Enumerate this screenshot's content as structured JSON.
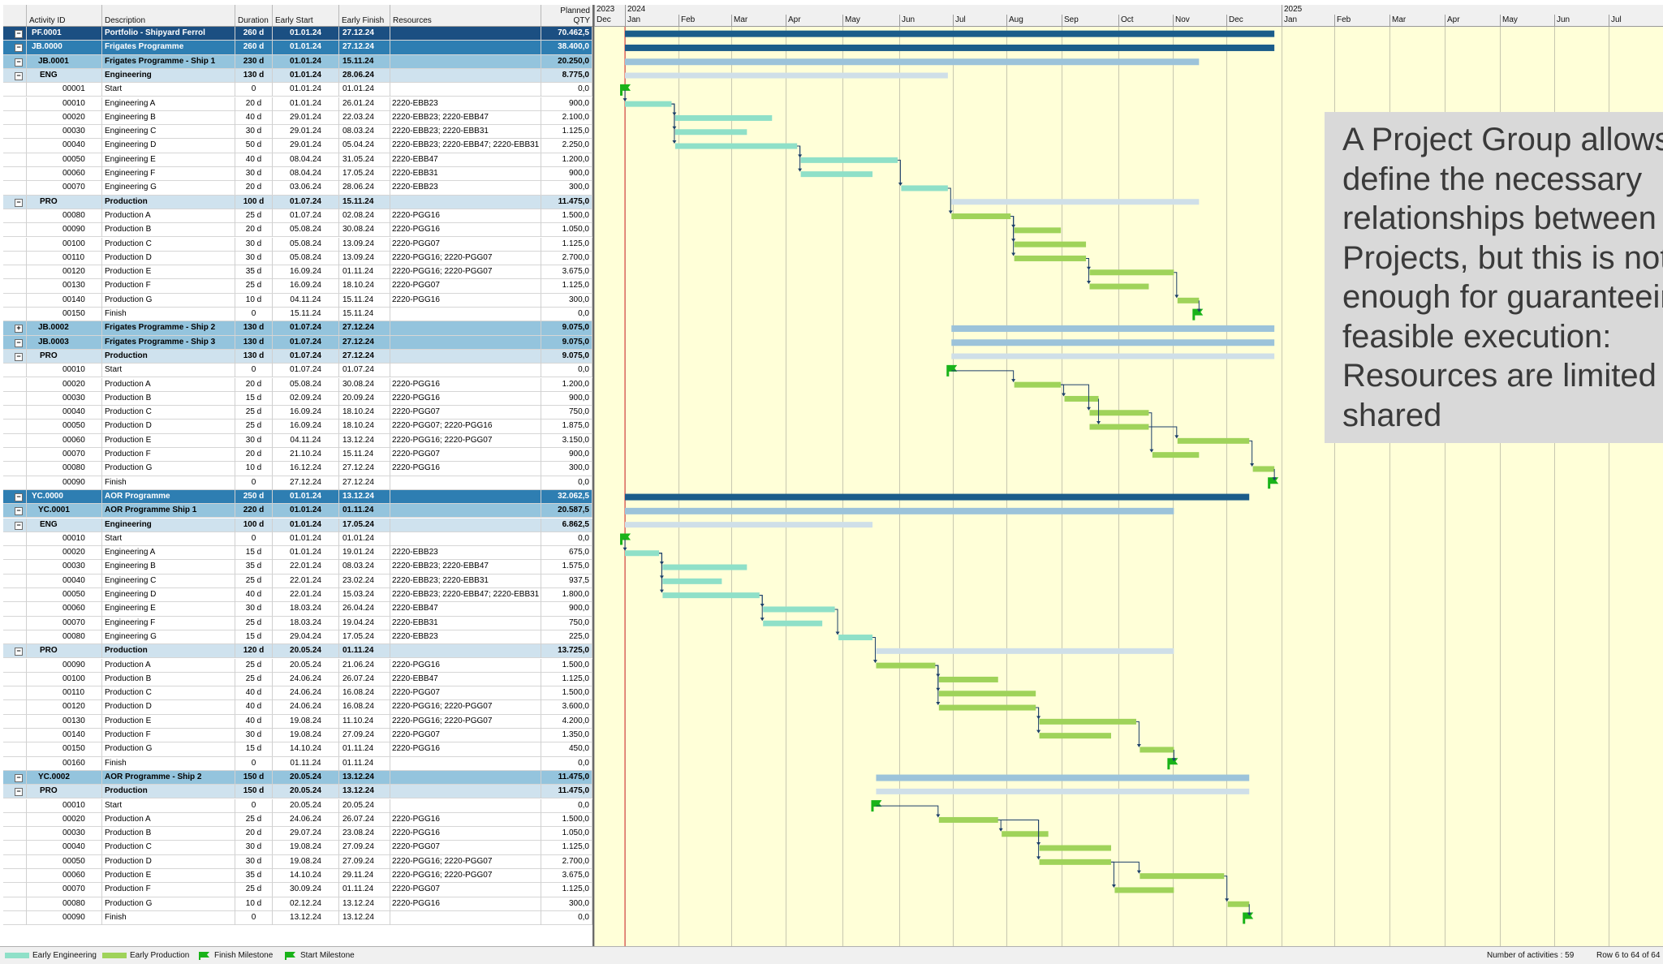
{
  "columns": {
    "id": "Activity ID",
    "desc": "Description",
    "duration": "Duration",
    "early_start": "Early Start",
    "early_finish": "Early Finish",
    "resources": "Resources",
    "qty_line1": "Planned",
    "qty_line2": "QTY"
  },
  "timeline": {
    "years": [
      "2023",
      "2024",
      "2025"
    ],
    "months": [
      "Dec",
      "Jan",
      "Feb",
      "Mar",
      "Apr",
      "May",
      "Jun",
      "Jul",
      "Aug",
      "Sep",
      "Oct",
      "Nov",
      "Dec",
      "Jan",
      "Feb",
      "Mar",
      "Apr",
      "May",
      "Jun",
      "Jul"
    ]
  },
  "rows": [
    {
      "level": 0,
      "toggle": "−",
      "id": "PF.0001",
      "desc": "Portfolio - Shipyard Ferrol",
      "dur": "260 d",
      "es": "01.01.24",
      "ef": "27.12.24",
      "res": "",
      "qty": "70.462,5"
    },
    {
      "level": 1,
      "toggle": "−",
      "id": "JB.0000",
      "desc": "Frigates Programme",
      "dur": "260 d",
      "es": "01.01.24",
      "ef": "27.12.24",
      "res": "",
      "qty": "38.400,0"
    },
    {
      "level": 2,
      "toggle": "−",
      "id": "JB.0001",
      "desc": "Frigates Programme - Ship 1",
      "dur": "230 d",
      "es": "01.01.24",
      "ef": "15.11.24",
      "res": "",
      "qty": "20.250,0"
    },
    {
      "level": 3,
      "toggle": "−",
      "id": "ENG",
      "desc": "Engineering",
      "dur": "130 d",
      "es": "01.01.24",
      "ef": "28.06.24",
      "res": "",
      "qty": "8.775,0"
    },
    {
      "level": 4,
      "id": "00001",
      "desc": "Start",
      "dur": "0",
      "es": "01.01.24",
      "ef": "01.01.24",
      "res": "",
      "qty": "0,0"
    },
    {
      "level": 4,
      "id": "00010",
      "desc": "Engineering A",
      "dur": "20 d",
      "es": "01.01.24",
      "ef": "26.01.24",
      "res": "2220-EBB23",
      "qty": "900,0"
    },
    {
      "level": 4,
      "id": "00020",
      "desc": "Engineering B",
      "dur": "40 d",
      "es": "29.01.24",
      "ef": "22.03.24",
      "res": "2220-EBB23; 2220-EBB47",
      "qty": "2.100,0"
    },
    {
      "level": 4,
      "id": "00030",
      "desc": "Engineering C",
      "dur": "30 d",
      "es": "29.01.24",
      "ef": "08.03.24",
      "res": "2220-EBB23; 2220-EBB31",
      "qty": "1.125,0"
    },
    {
      "level": 4,
      "id": "00040",
      "desc": "Engineering D",
      "dur": "50 d",
      "es": "29.01.24",
      "ef": "05.04.24",
      "res": "2220-EBB23; 2220-EBB47; 2220-EBB31",
      "qty": "2.250,0"
    },
    {
      "level": 4,
      "id": "00050",
      "desc": "Engineering E",
      "dur": "40 d",
      "es": "08.04.24",
      "ef": "31.05.24",
      "res": "2220-EBB47",
      "qty": "1.200,0"
    },
    {
      "level": 4,
      "id": "00060",
      "desc": "Engineering F",
      "dur": "30 d",
      "es": "08.04.24",
      "ef": "17.05.24",
      "res": "2220-EBB31",
      "qty": "900,0"
    },
    {
      "level": 4,
      "id": "00070",
      "desc": "Engineering G",
      "dur": "20 d",
      "es": "03.06.24",
      "ef": "28.06.24",
      "res": "2220-EBB23",
      "qty": "300,0"
    },
    {
      "level": 3,
      "toggle": "−",
      "id": "PRO",
      "desc": "Production",
      "dur": "100 d",
      "es": "01.07.24",
      "ef": "15.11.24",
      "res": "",
      "qty": "11.475,0"
    },
    {
      "level": 4,
      "id": "00080",
      "desc": "Production A",
      "dur": "25 d",
      "es": "01.07.24",
      "ef": "02.08.24",
      "res": "2220-PGG16",
      "qty": "1.500,0"
    },
    {
      "level": 4,
      "id": "00090",
      "desc": "Production B",
      "dur": "20 d",
      "es": "05.08.24",
      "ef": "30.08.24",
      "res": "2220-PGG16",
      "qty": "1.050,0"
    },
    {
      "level": 4,
      "id": "00100",
      "desc": "Production C",
      "dur": "30 d",
      "es": "05.08.24",
      "ef": "13.09.24",
      "res": "2220-PGG07",
      "qty": "1.125,0"
    },
    {
      "level": 4,
      "id": "00110",
      "desc": "Production D",
      "dur": "30 d",
      "es": "05.08.24",
      "ef": "13.09.24",
      "res": "2220-PGG16; 2220-PGG07",
      "qty": "2.700,0"
    },
    {
      "level": 4,
      "id": "00120",
      "desc": "Production E",
      "dur": "35 d",
      "es": "16.09.24",
      "ef": "01.11.24",
      "res": "2220-PGG16; 2220-PGG07",
      "qty": "3.675,0"
    },
    {
      "level": 4,
      "id": "00130",
      "desc": "Production F",
      "dur": "25 d",
      "es": "16.09.24",
      "ef": "18.10.24",
      "res": "2220-PGG07",
      "qty": "1.125,0"
    },
    {
      "level": 4,
      "id": "00140",
      "desc": "Production G",
      "dur": "10 d",
      "es": "04.11.24",
      "ef": "15.11.24",
      "res": "2220-PGG16",
      "qty": "300,0"
    },
    {
      "level": 4,
      "id": "00150",
      "desc": "Finish",
      "dur": "0",
      "es": "15.11.24",
      "ef": "15.11.24",
      "res": "",
      "qty": "0,0"
    },
    {
      "level": 2,
      "toggle": "+",
      "id": "JB.0002",
      "desc": "Frigates Programme - Ship 2",
      "dur": "130 d",
      "es": "01.07.24",
      "ef": "27.12.24",
      "res": "",
      "qty": "9.075,0"
    },
    {
      "level": 2,
      "toggle": "−",
      "id": "JB.0003",
      "desc": "Frigates Programme - Ship 3",
      "dur": "130 d",
      "es": "01.07.24",
      "ef": "27.12.24",
      "res": "",
      "qty": "9.075,0"
    },
    {
      "level": 3,
      "toggle": "−",
      "id": "PRO",
      "desc": "Production",
      "dur": "130 d",
      "es": "01.07.24",
      "ef": "27.12.24",
      "res": "",
      "qty": "9.075,0"
    },
    {
      "level": 4,
      "id": "00010",
      "desc": "Start",
      "dur": "0",
      "es": "01.07.24",
      "ef": "01.07.24",
      "res": "",
      "qty": "0,0"
    },
    {
      "level": 4,
      "id": "00020",
      "desc": "Production A",
      "dur": "20 d",
      "es": "05.08.24",
      "ef": "30.08.24",
      "res": "2220-PGG16",
      "qty": "1.200,0"
    },
    {
      "level": 4,
      "id": "00030",
      "desc": "Production B",
      "dur": "15 d",
      "es": "02.09.24",
      "ef": "20.09.24",
      "res": "2220-PGG16",
      "qty": "900,0"
    },
    {
      "level": 4,
      "id": "00040",
      "desc": "Production C",
      "dur": "25 d",
      "es": "16.09.24",
      "ef": "18.10.24",
      "res": "2220-PGG07",
      "qty": "750,0"
    },
    {
      "level": 4,
      "id": "00050",
      "desc": "Production D",
      "dur": "25 d",
      "es": "16.09.24",
      "ef": "18.10.24",
      "res": "2220-PGG07; 2220-PGG16",
      "qty": "1.875,0"
    },
    {
      "level": 4,
      "id": "00060",
      "desc": "Production E",
      "dur": "30 d",
      "es": "04.11.24",
      "ef": "13.12.24",
      "res": "2220-PGG16; 2220-PGG07",
      "qty": "3.150,0"
    },
    {
      "level": 4,
      "id": "00070",
      "desc": "Production F",
      "dur": "20 d",
      "es": "21.10.24",
      "ef": "15.11.24",
      "res": "2220-PGG07",
      "qty": "900,0"
    },
    {
      "level": 4,
      "id": "00080",
      "desc": "Production G",
      "dur": "10 d",
      "es": "16.12.24",
      "ef": "27.12.24",
      "res": "2220-PGG16",
      "qty": "300,0"
    },
    {
      "level": 4,
      "id": "00090",
      "desc": "Finish",
      "dur": "0",
      "es": "27.12.24",
      "ef": "27.12.24",
      "res": "",
      "qty": "0,0"
    },
    {
      "level": 1,
      "toggle": "−",
      "id": "YC.0000",
      "desc": "AOR Programme",
      "dur": "250 d",
      "es": "01.01.24",
      "ef": "13.12.24",
      "res": "",
      "qty": "32.062,5"
    },
    {
      "level": 2,
      "toggle": "−",
      "id": "YC.0001",
      "desc": "AOR Programme Ship 1",
      "dur": "220 d",
      "es": "01.01.24",
      "ef": "01.11.24",
      "res": "",
      "qty": "20.587,5"
    },
    {
      "level": 3,
      "toggle": "−",
      "id": "ENG",
      "desc": "Engineering",
      "dur": "100 d",
      "es": "01.01.24",
      "ef": "17.05.24",
      "res": "",
      "qty": "6.862,5"
    },
    {
      "level": 4,
      "id": "00010",
      "desc": "Start",
      "dur": "0",
      "es": "01.01.24",
      "ef": "01.01.24",
      "res": "",
      "qty": "0,0"
    },
    {
      "level": 4,
      "id": "00020",
      "desc": "Engineering A",
      "dur": "15 d",
      "es": "01.01.24",
      "ef": "19.01.24",
      "res": "2220-EBB23",
      "qty": "675,0"
    },
    {
      "level": 4,
      "id": "00030",
      "desc": "Engineering B",
      "dur": "35 d",
      "es": "22.01.24",
      "ef": "08.03.24",
      "res": "2220-EBB23; 2220-EBB47",
      "qty": "1.575,0"
    },
    {
      "level": 4,
      "id": "00040",
      "desc": "Engineering C",
      "dur": "25 d",
      "es": "22.01.24",
      "ef": "23.02.24",
      "res": "2220-EBB23; 2220-EBB31",
      "qty": "937,5"
    },
    {
      "level": 4,
      "id": "00050",
      "desc": "Engineering D",
      "dur": "40 d",
      "es": "22.01.24",
      "ef": "15.03.24",
      "res": "2220-EBB23; 2220-EBB47; 2220-EBB31",
      "qty": "1.800,0"
    },
    {
      "level": 4,
      "id": "00060",
      "desc": "Engineering E",
      "dur": "30 d",
      "es": "18.03.24",
      "ef": "26.04.24",
      "res": "2220-EBB47",
      "qty": "900,0"
    },
    {
      "level": 4,
      "id": "00070",
      "desc": "Engineering F",
      "dur": "25 d",
      "es": "18.03.24",
      "ef": "19.04.24",
      "res": "2220-EBB31",
      "qty": "750,0"
    },
    {
      "level": 4,
      "id": "00080",
      "desc": "Engineering G",
      "dur": "15 d",
      "es": "29.04.24",
      "ef": "17.05.24",
      "res": "2220-EBB23",
      "qty": "225,0"
    },
    {
      "level": 3,
      "toggle": "−",
      "id": "PRO",
      "desc": "Production",
      "dur": "120 d",
      "es": "20.05.24",
      "ef": "01.11.24",
      "res": "",
      "qty": "13.725,0"
    },
    {
      "level": 4,
      "id": "00090",
      "desc": "Production A",
      "dur": "25 d",
      "es": "20.05.24",
      "ef": "21.06.24",
      "res": "2220-PGG16",
      "qty": "1.500,0"
    },
    {
      "level": 4,
      "id": "00100",
      "desc": "Production B",
      "dur": "25 d",
      "es": "24.06.24",
      "ef": "26.07.24",
      "res": "2220-EBB47",
      "qty": "1.125,0"
    },
    {
      "level": 4,
      "id": "00110",
      "desc": "Production C",
      "dur": "40 d",
      "es": "24.06.24",
      "ef": "16.08.24",
      "res": "2220-PGG07",
      "qty": "1.500,0"
    },
    {
      "level": 4,
      "id": "00120",
      "desc": "Production D",
      "dur": "40 d",
      "es": "24.06.24",
      "ef": "16.08.24",
      "res": "2220-PGG16; 2220-PGG07",
      "qty": "3.600,0"
    },
    {
      "level": 4,
      "id": "00130",
      "desc": "Production E",
      "dur": "40 d",
      "es": "19.08.24",
      "ef": "11.10.24",
      "res": "2220-PGG16; 2220-PGG07",
      "qty": "4.200,0"
    },
    {
      "level": 4,
      "id": "00140",
      "desc": "Production F",
      "dur": "30 d",
      "es": "19.08.24",
      "ef": "27.09.24",
      "res": "2220-PGG07",
      "qty": "1.350,0"
    },
    {
      "level": 4,
      "id": "00150",
      "desc": "Production G",
      "dur": "15 d",
      "es": "14.10.24",
      "ef": "01.11.24",
      "res": "2220-PGG16",
      "qty": "450,0"
    },
    {
      "level": 4,
      "id": "00160",
      "desc": "Finish",
      "dur": "0",
      "es": "01.11.24",
      "ef": "01.11.24",
      "res": "",
      "qty": "0,0"
    },
    {
      "level": 2,
      "toggle": "−",
      "id": "YC.0002",
      "desc": "AOR Programme - Ship 2",
      "dur": "150 d",
      "es": "20.05.24",
      "ef": "13.12.24",
      "res": "",
      "qty": "11.475,0"
    },
    {
      "level": 3,
      "toggle": "−",
      "id": "PRO",
      "desc": "Production",
      "dur": "150 d",
      "es": "20.05.24",
      "ef": "13.12.24",
      "res": "",
      "qty": "11.475,0"
    },
    {
      "level": 4,
      "id": "00010",
      "desc": "Start",
      "dur": "0",
      "es": "20.05.24",
      "ef": "20.05.24",
      "res": "",
      "qty": "0,0"
    },
    {
      "level": 4,
      "id": "00020",
      "desc": "Production A",
      "dur": "25 d",
      "es": "24.06.24",
      "ef": "26.07.24",
      "res": "2220-PGG16",
      "qty": "1.500,0"
    },
    {
      "level": 4,
      "id": "00030",
      "desc": "Production B",
      "dur": "20 d",
      "es": "29.07.24",
      "ef": "23.08.24",
      "res": "2220-PGG16",
      "qty": "1.050,0"
    },
    {
      "level": 4,
      "id": "00040",
      "desc": "Production C",
      "dur": "30 d",
      "es": "19.08.24",
      "ef": "27.09.24",
      "res": "2220-PGG07",
      "qty": "1.125,0"
    },
    {
      "level": 4,
      "id": "00050",
      "desc": "Production D",
      "dur": "30 d",
      "es": "19.08.24",
      "ef": "27.09.24",
      "res": "2220-PGG16; 2220-PGG07",
      "qty": "2.700,0"
    },
    {
      "level": 4,
      "id": "00060",
      "desc": "Production E",
      "dur": "35 d",
      "es": "14.10.24",
      "ef": "29.11.24",
      "res": "2220-PGG16; 2220-PGG07",
      "qty": "3.675,0"
    },
    {
      "level": 4,
      "id": "00070",
      "desc": "Production F",
      "dur": "25 d",
      "es": "30.09.24",
      "ef": "01.11.24",
      "res": "2220-PGG07",
      "qty": "1.125,0"
    },
    {
      "level": 4,
      "id": "00080",
      "desc": "Production G",
      "dur": "10 d",
      "es": "02.12.24",
      "ef": "13.12.24",
      "res": "2220-PGG16",
      "qty": "300,0"
    },
    {
      "level": 4,
      "id": "00090",
      "desc": "Finish",
      "dur": "0",
      "es": "13.12.24",
      "ef": "13.12.24",
      "res": "",
      "qty": "0,0"
    }
  ],
  "callout": {
    "text": "A Project Group allows to\ndefine the necessary\nrelationships between\nProjects, but this is not\nenough for guaranteeing\nfeasible execution:\nResources are limited and\nshared"
  },
  "legend": [
    {
      "label": "Early Engineering",
      "color": "#8fe0c8",
      "kind": "bar"
    },
    {
      "label": "Early Production",
      "color": "#9fd35a",
      "kind": "bar"
    },
    {
      "label": "Finish Milestone",
      "color": "#19b319",
      "kind": "flag"
    },
    {
      "label": "Start Milestone",
      "color": "#19b319",
      "kind": "flag"
    }
  ],
  "status": {
    "count": "Number of activities : 59",
    "rows": "Row 6 to 64 of 64"
  },
  "colors": {
    "today_line": "#e03030",
    "link": "#1c3f6a",
    "eng_bar": "#8fe0c8",
    "prod_bar": "#9fd35a",
    "summary_dark": "#1b5c8a",
    "summary_mid": "#9cc3da",
    "summary_light": "#cfdfe8",
    "milestone": "#19b319",
    "gantt_bg": "#ffffd8"
  }
}
